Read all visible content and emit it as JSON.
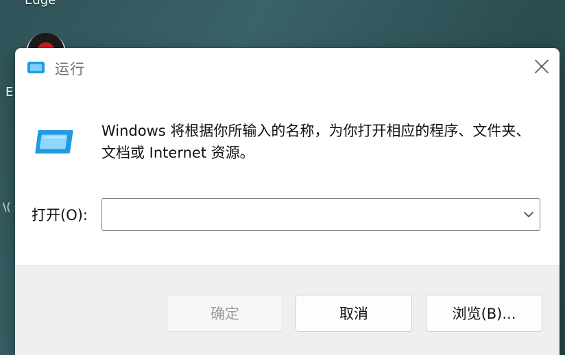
{
  "desktop": {
    "top_label": "Edge",
    "edge_letter": "E",
    "edge_mark": "\\("
  },
  "dialog": {
    "title": "运行",
    "description": "Windows 将根据你所输入的名称，为你打开相应的程序、文件夹、文档或 Internet 资源。",
    "open_label": "打开(O):",
    "open_input": {
      "value": "",
      "placeholder": ""
    },
    "buttons": {
      "ok": "确定",
      "cancel": "取消",
      "browse": "浏览(B)..."
    }
  },
  "icons": {
    "title": "run-app-icon",
    "main": "run-app-icon",
    "close": "close-icon",
    "dropdown": "chevron-down-icon"
  },
  "colors": {
    "accent": "#1f9ae3",
    "accent_light": "#7fd0ff",
    "dialog_bg": "#ffffff",
    "footer_bg": "#efefef",
    "title_text": "#707070",
    "disabled_text": "#9b9b9b"
  }
}
